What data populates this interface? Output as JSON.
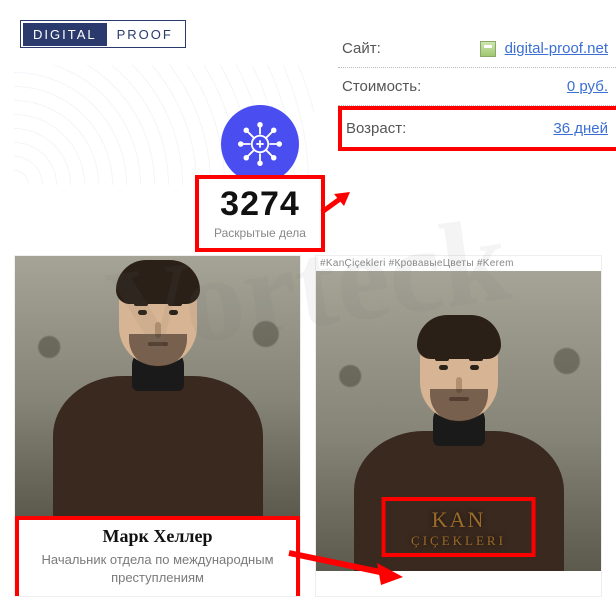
{
  "watermark": "Vorteck",
  "logo": {
    "left": "DIGITAL",
    "right": "PROOF"
  },
  "stat": {
    "number": "3274",
    "label": "Раскрытые дела"
  },
  "info": {
    "site_label": "Сайт:",
    "site_link": "digital-proof.net",
    "cost_label": "Стоимость:",
    "cost_value": "0 руб.",
    "age_label": "Возраст:",
    "age_value": "36 дней"
  },
  "left_card": {
    "name": "Марк Хеллер",
    "role": "Начальник отдела по международным преступлениям"
  },
  "right_card": {
    "tags": "#KanÇiçekleri #КровавыеЦветы #Kerem",
    "title_l1": "KAN",
    "title_l2": "ÇIÇEKLERI"
  }
}
